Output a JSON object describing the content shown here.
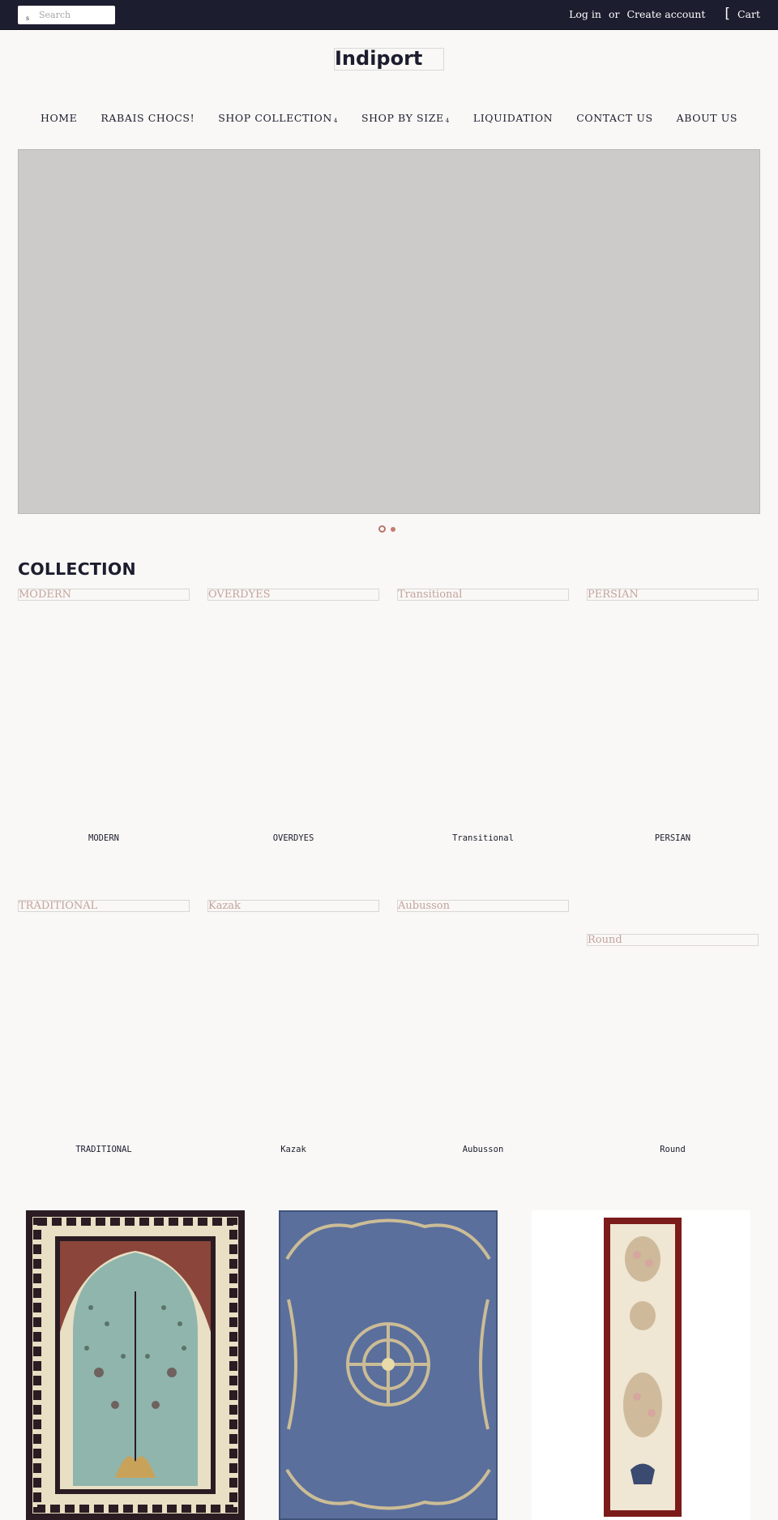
{
  "topbar": {
    "search_placeholder": "Search",
    "search_icon_glyph": "s",
    "login_label": "Log in",
    "or_label": "or",
    "create_account_label": "Create account",
    "cart_icon_glyph": "[",
    "cart_label": "Cart"
  },
  "brand": {
    "logo_text": "Indiport"
  },
  "nav": {
    "items": [
      {
        "label": "HOME",
        "has_dropdown": false
      },
      {
        "label": "RABAIS CHOCS!",
        "has_dropdown": false
      },
      {
        "label": "SHOP COLLECTION",
        "has_dropdown": true
      },
      {
        "label": "SHOP BY SIZE",
        "has_dropdown": true
      },
      {
        "label": "LIQUIDATION",
        "has_dropdown": false
      },
      {
        "label": "CONTACT US",
        "has_dropdown": false
      },
      {
        "label": "ABOUT US",
        "has_dropdown": false
      }
    ],
    "dropdown_glyph": "4"
  },
  "slideshow": {
    "slide_count": 2,
    "active_index": 1
  },
  "collection": {
    "title": "COLLECTION",
    "items": [
      {
        "image_alt": "MODERN",
        "caption": "MODERN"
      },
      {
        "image_alt": "OVERDYES",
        "caption": "OVERDYES"
      },
      {
        "image_alt": "Transitional",
        "caption": "Transitional"
      },
      {
        "image_alt": "PERSIAN",
        "caption": "PERSIAN"
      },
      {
        "image_alt": "TRADITIONAL",
        "caption": "TRADITIONAL"
      },
      {
        "image_alt": "Kazak",
        "caption": "Kazak"
      },
      {
        "image_alt": "Aubusson",
        "caption": "Aubusson"
      },
      {
        "image_alt": "Round",
        "caption": "Round"
      }
    ]
  },
  "products": [
    {
      "name": "teal-tree-of-life-prayer-rug",
      "colors": {
        "field": "#8fb5ad",
        "border": "#2a1c22",
        "accent": "#7a2a22",
        "cream": "#e8dfc4"
      }
    },
    {
      "name": "blue-aubusson-medallion-rug",
      "colors": {
        "field": "#5a6f9c",
        "ornament": "#d8c596",
        "dark": "#4e4a3a"
      }
    },
    {
      "name": "red-aubusson-floral-runner",
      "colors": {
        "field": "#efe6d3",
        "border": "#7b1c1a",
        "floral": "#c7b08e"
      }
    }
  ],
  "colors": {
    "topbar_bg": "#1c1d2e",
    "page_bg": "#f9f8f6",
    "accent": "#c47c6d",
    "alt_text": "#c4a39c"
  }
}
